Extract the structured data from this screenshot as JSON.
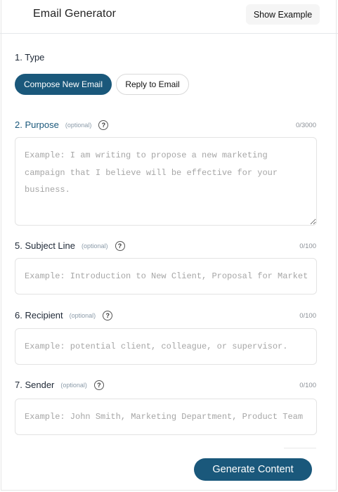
{
  "header": {
    "title": "Email Generator",
    "show_example_label": "Show Example"
  },
  "type_section": {
    "label": "1. Type",
    "options": [
      "Compose New Email",
      "Reply to Email"
    ],
    "selected": "Compose New Email"
  },
  "fields": {
    "purpose": {
      "label": "2. Purpose",
      "optional": "(optional)",
      "help": "?",
      "counter": "0/3000",
      "placeholder": "Example: I am writing to propose a new marketing campaign that I believe will be effective for your business."
    },
    "subject": {
      "label": "5. Subject Line",
      "optional": "(optional)",
      "help": "?",
      "counter": "0/100",
      "placeholder": "Example: Introduction to New Client, Proposal for Marketing Campaign"
    },
    "recipient": {
      "label": "6. Recipient",
      "optional": "(optional)",
      "help": "?",
      "counter": "0/100",
      "placeholder": "Example: potential client, colleague, or supervisor."
    },
    "sender": {
      "label": "7. Sender",
      "optional": "(optional)",
      "help": "?",
      "counter": "0/100",
      "placeholder": "Example: John Smith, Marketing Department, Product Team"
    }
  },
  "actions": {
    "generate_label": "Generate Content"
  },
  "colors": {
    "accent": "#1a587b",
    "border": "#e3e3e3",
    "placeholder": "#a6a6a6"
  }
}
